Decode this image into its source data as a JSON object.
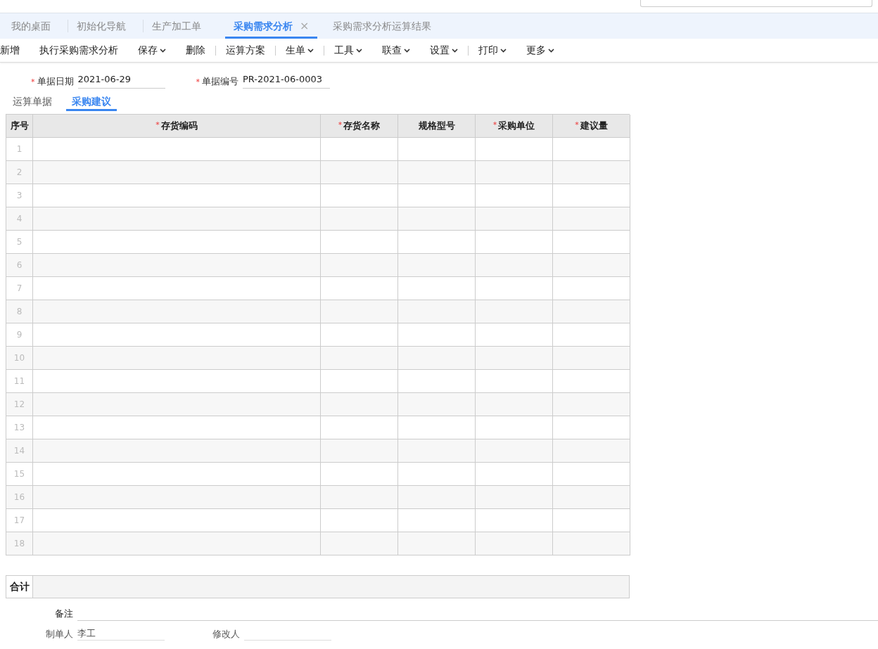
{
  "tabs": [
    {
      "label": "我的桌面",
      "selected": false
    },
    {
      "label": "初始化导航",
      "selected": false
    },
    {
      "label": "生产加工单",
      "selected": false
    },
    {
      "label": "采购需求分析",
      "selected": true,
      "close": "×"
    },
    {
      "label": "采购需求分析运算结果",
      "selected": false
    }
  ],
  "toolbar": [
    {
      "kind": "button",
      "label": "新增",
      "dropdown": false
    },
    {
      "kind": "button",
      "label": "执行采购需求分析",
      "dropdown": false
    },
    {
      "kind": "button",
      "label": "保存",
      "dropdown": true
    },
    {
      "kind": "button",
      "label": "删除",
      "dropdown": false
    },
    {
      "kind": "divider"
    },
    {
      "kind": "button",
      "label": "运算方案",
      "dropdown": false
    },
    {
      "kind": "divider"
    },
    {
      "kind": "button",
      "label": "生单",
      "dropdown": true
    },
    {
      "kind": "divider"
    },
    {
      "kind": "button",
      "label": "工具",
      "dropdown": true
    },
    {
      "kind": "button",
      "label": "联查",
      "dropdown": true
    },
    {
      "kind": "button",
      "label": "设置",
      "dropdown": true
    },
    {
      "kind": "divider"
    },
    {
      "kind": "button",
      "label": "打印",
      "dropdown": true
    },
    {
      "kind": "button",
      "label": "更多",
      "dropdown": true
    }
  ],
  "header_fields": [
    {
      "label": "单据日期",
      "required_mark": "*",
      "value": "2021-06-29"
    },
    {
      "label": "单据编号",
      "required_mark": "*",
      "value": "PR-2021-06-0003"
    }
  ],
  "sub_tabs": [
    {
      "label": "运算单据",
      "selected": false
    },
    {
      "label": "采购建议",
      "selected": true
    }
  ],
  "table": {
    "columns": [
      {
        "label": "序号"
      },
      {
        "label": "存货编码",
        "required_mark": "*"
      },
      {
        "label": "存货名称",
        "required_mark": "*"
      },
      {
        "label": "规格型号"
      },
      {
        "label": "采购单位",
        "required_mark": "*"
      },
      {
        "label": "建议量",
        "required_mark": "*"
      }
    ],
    "rows": [
      "1",
      "2",
      "3",
      "4",
      "5",
      "6",
      "7",
      "8",
      "9",
      "10",
      "11",
      "12",
      "13",
      "14",
      "15",
      "16",
      "17",
      "18"
    ],
    "total_label": "合计"
  },
  "footer": {
    "remark_label": "备注",
    "creator_label": "制单人",
    "creator": "李工",
    "modifier_label": "修改人"
  }
}
